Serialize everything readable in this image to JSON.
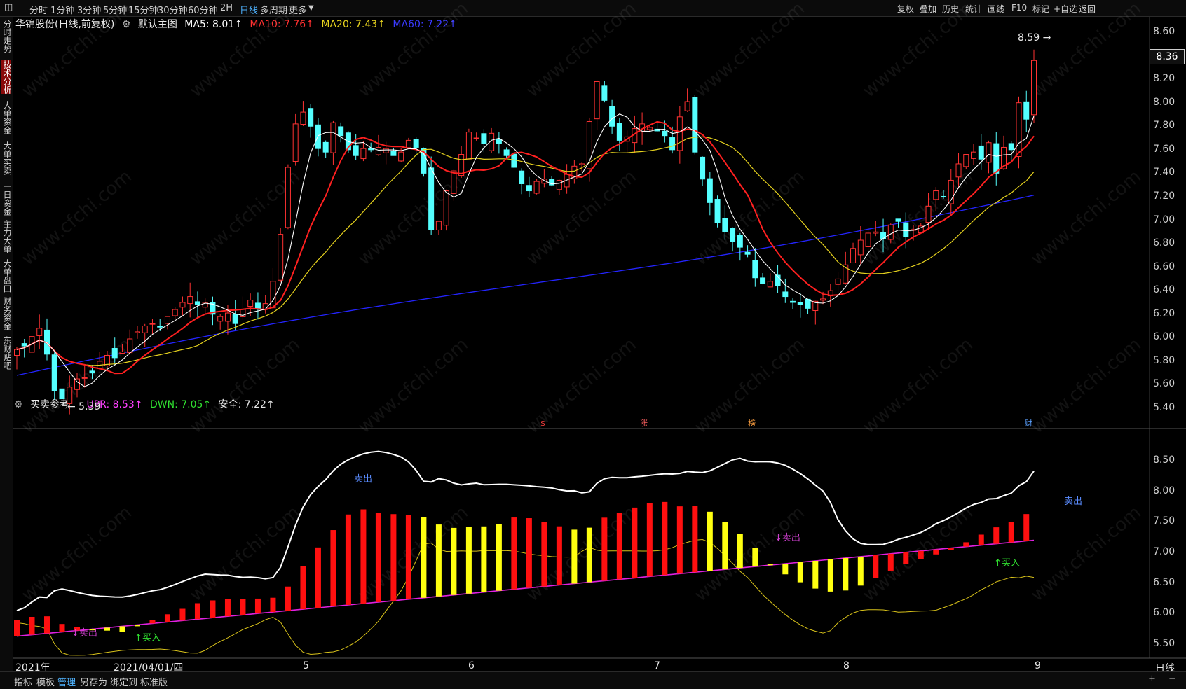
{
  "toolbar": {
    "period_tabs": [
      "分时",
      "1分钟",
      "3分钟",
      "5分钟",
      "15分钟",
      "30分钟",
      "60分钟",
      "2H",
      "日线",
      "多周期",
      "更多"
    ],
    "active_period": "日线",
    "right_items": [
      "复权",
      "叠加",
      "历史",
      "统计",
      "画线",
      "F10",
      "标记",
      "+自选",
      "返回"
    ]
  },
  "sidebar": {
    "tabs": [
      "分时走势",
      "技术分析",
      "大单资金",
      "大单买卖",
      "一日资金",
      "主力大单",
      "大单盘口",
      "财务资金",
      "东财贴吧"
    ],
    "active": "技术分析"
  },
  "main_legend": {
    "stock": "华锦股份(日线,前复权)",
    "chart_name": "默认主图",
    "ma5": "MA5: 8.01↑",
    "ma10": "MA10: 7.76↑",
    "ma20": "MA20: 7.43↑",
    "ma60": "MA60: 7.22↑",
    "colors": {
      "ma5": "#ffffff",
      "ma10": "#ff2020",
      "ma20": "#e6d21e",
      "ma60": "#2424ff",
      "up": "#ff3232",
      "down": "#54ffff"
    }
  },
  "sub_legend": {
    "name": "买卖参考",
    "upr": "UPR: 8.53↑",
    "dwn": "DWN: 7.05↑",
    "safe": "安全: 7.22↑"
  },
  "price_axis": [
    "8.60",
    "8.40",
    "8.20",
    "8.00",
    "7.80",
    "7.60",
    "7.40",
    "7.20",
    "7.00",
    "6.80",
    "6.60",
    "6.40",
    "6.20",
    "6.00",
    "5.80",
    "5.60",
    "5.40"
  ],
  "current_price": "8.36",
  "sub_axis": [
    "8.50",
    "8.00",
    "7.50",
    "7.00",
    "6.50",
    "6.00",
    "5.50"
  ],
  "date_axis": [
    "2021年",
    "2021/04/01/四",
    "5",
    "6",
    "7",
    "8",
    "9"
  ],
  "period_label": "日线",
  "annotations": {
    "high": "8.59",
    "low": "5.39",
    "events": [
      "$",
      "涨",
      "榜",
      "财"
    ],
    "sell": "卖出",
    "buy": "买入"
  },
  "bottom_tabs": [
    "指标",
    "模板",
    "管理",
    "另存为",
    "绑定到",
    "标准版"
  ],
  "watermark": "www.cfchi.com",
  "chart_data": {
    "type": "candlestick",
    "title": "华锦股份(日线,前复权)",
    "ylim": [
      5.3,
      8.65
    ],
    "high": 8.59,
    "low": 5.39,
    "last_close": 8.36,
    "indicators": {
      "MA5": 8.01,
      "MA10": 7.76,
      "MA20": 7.43,
      "MA60": 7.22,
      "UPR": 8.53,
      "DWN": 7.05,
      "安全": 7.22
    }
  }
}
